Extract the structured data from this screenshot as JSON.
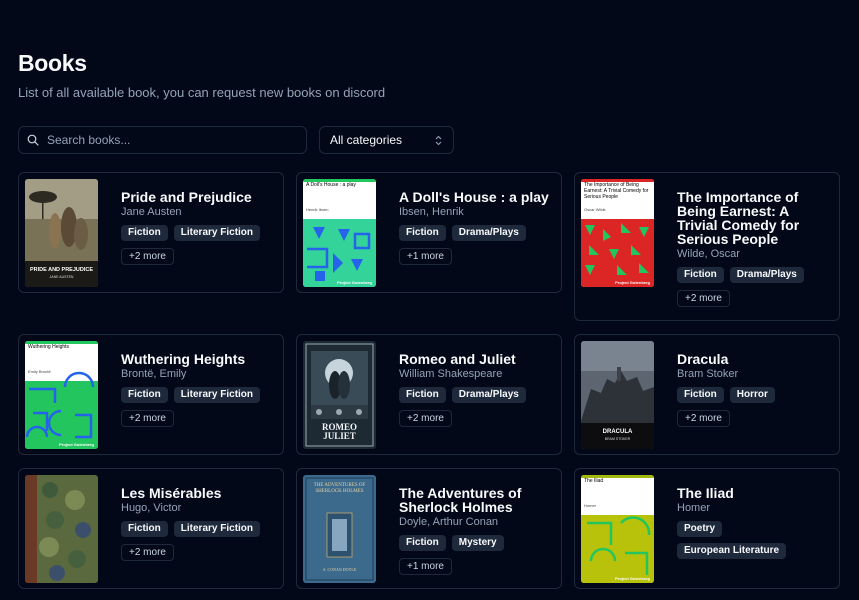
{
  "header": {
    "title": "Books",
    "subtitle": "List of all available book, you can request new books on discord"
  },
  "search": {
    "placeholder": "Search books..."
  },
  "filter": {
    "selected": "All categories"
  },
  "books": [
    {
      "title": "Pride and Prejudice",
      "author": "Jane Austen",
      "tags": [
        "Fiction",
        "Literary Fiction"
      ],
      "more": "+2 more",
      "cover_title": "PRIDE AND PREJUDICE",
      "cover_author": "JANE AUSTEN"
    },
    {
      "title": "A Doll's House : a play",
      "author": "Ibsen, Henrik",
      "tags": [
        "Fiction",
        "Drama/Plays"
      ],
      "more": "+1 more",
      "cover_title": "A Doll's House : a play",
      "cover_author": "Henrik Ibsen",
      "cover_foot": "Project Gutenberg"
    },
    {
      "title": "The Importance of Being Earnest: A Trivial Comedy for Serious People",
      "author": "Wilde, Oscar",
      "tags": [
        "Fiction",
        "Drama/Plays"
      ],
      "more": "+2 more",
      "cover_title": "The Importance of Being Earnest: A Trivial Comedy for Serious People",
      "cover_author": "Oscar Wilde",
      "cover_foot": "Project Gutenberg"
    },
    {
      "title": "Wuthering Heights",
      "author": "Brontë, Emily",
      "tags": [
        "Fiction",
        "Literary Fiction"
      ],
      "more": "+2 more",
      "cover_title": "Wuthering Heights",
      "cover_author": "Emily Brontë",
      "cover_foot": "Project Gutenberg"
    },
    {
      "title": "Romeo and Juliet",
      "author": "William Shakespeare",
      "tags": [
        "Fiction",
        "Drama/Plays"
      ],
      "more": "+2 more",
      "cover_title": "ROMEO JULIET"
    },
    {
      "title": "Dracula",
      "author": "Bram Stoker",
      "tags": [
        "Fiction",
        "Horror"
      ],
      "more": "+2 more",
      "cover_title": "DRACULA",
      "cover_author": "BRAM STOKER"
    },
    {
      "title": "Les Misérables",
      "author": "Hugo, Victor",
      "tags": [
        "Fiction",
        "Literary Fiction"
      ],
      "more": "+2 more"
    },
    {
      "title": "The Adventures of Sherlock Holmes",
      "author": "Doyle, Arthur Conan",
      "tags": [
        "Fiction",
        "Mystery"
      ],
      "more": "+1 more",
      "cover_title": "THE ADVENTURES OF SHERLOCK HOLMES",
      "cover_author": "A. CONAN DOYLE"
    },
    {
      "title": "The Iliad",
      "author": "Homer",
      "tags": [
        "Poetry",
        "European Literature"
      ],
      "cover_title": "The Iliad",
      "cover_author": "Homer",
      "cover_foot": "Project Gutenberg"
    }
  ],
  "colors": {
    "background": "#020817",
    "border": "#1e293b",
    "tag_bg": "#1e293b",
    "muted_text": "#94a3b8"
  }
}
